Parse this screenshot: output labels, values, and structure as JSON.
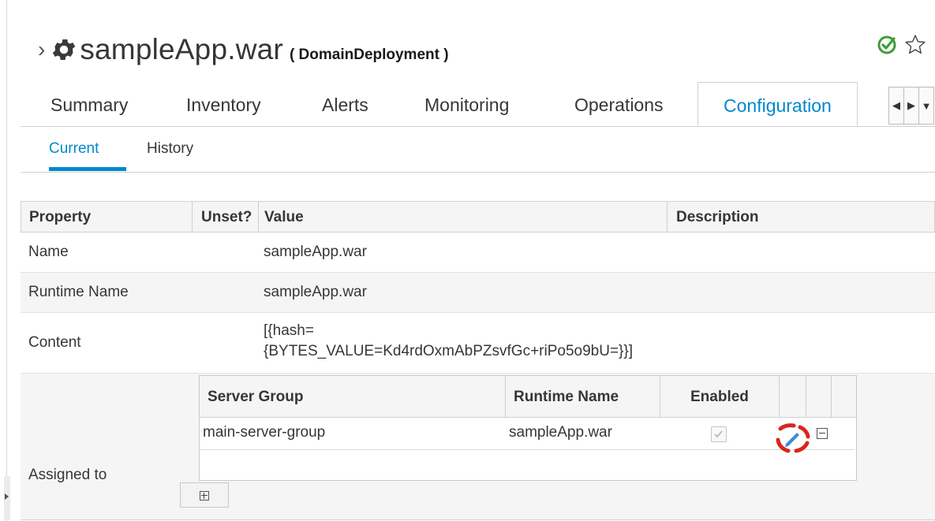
{
  "header": {
    "chevron": "›",
    "resource_name": "sampleApp.war",
    "resource_type": "( DomainDeployment )",
    "status_icon": "check-circle-icon",
    "favorite_icon": "star-outline-icon",
    "accent_color": "#0088ce",
    "status_color": "#3f9c35"
  },
  "tabs": [
    {
      "label": "Summary"
    },
    {
      "label": "Inventory"
    },
    {
      "label": "Alerts"
    },
    {
      "label": "Monitoring"
    },
    {
      "label": "Operations"
    },
    {
      "label": "Configuration",
      "active": true
    }
  ],
  "subtabs": [
    {
      "label": "Current",
      "active": true
    },
    {
      "label": "History"
    }
  ],
  "properties": {
    "columns": [
      "Property",
      "Unset?",
      "Value",
      "Description"
    ],
    "rows": [
      {
        "name": "Name",
        "value": "sampleApp.war"
      },
      {
        "name": "Runtime Name",
        "value": "sampleApp.war"
      },
      {
        "name": "Content",
        "value_line1": "[{hash=",
        "value_line2": "{BYTES_VALUE=Kd4rdOxmAbPZsvfGc+riPo5o9bU=}}]"
      },
      {
        "name": "Assigned to"
      }
    ]
  },
  "server_groups": {
    "columns": [
      "Server Group",
      "Runtime Name",
      "Enabled"
    ],
    "rows": [
      {
        "server_group": "main-server-group",
        "runtime_name": "sampleApp.war",
        "enabled": true
      }
    ]
  }
}
